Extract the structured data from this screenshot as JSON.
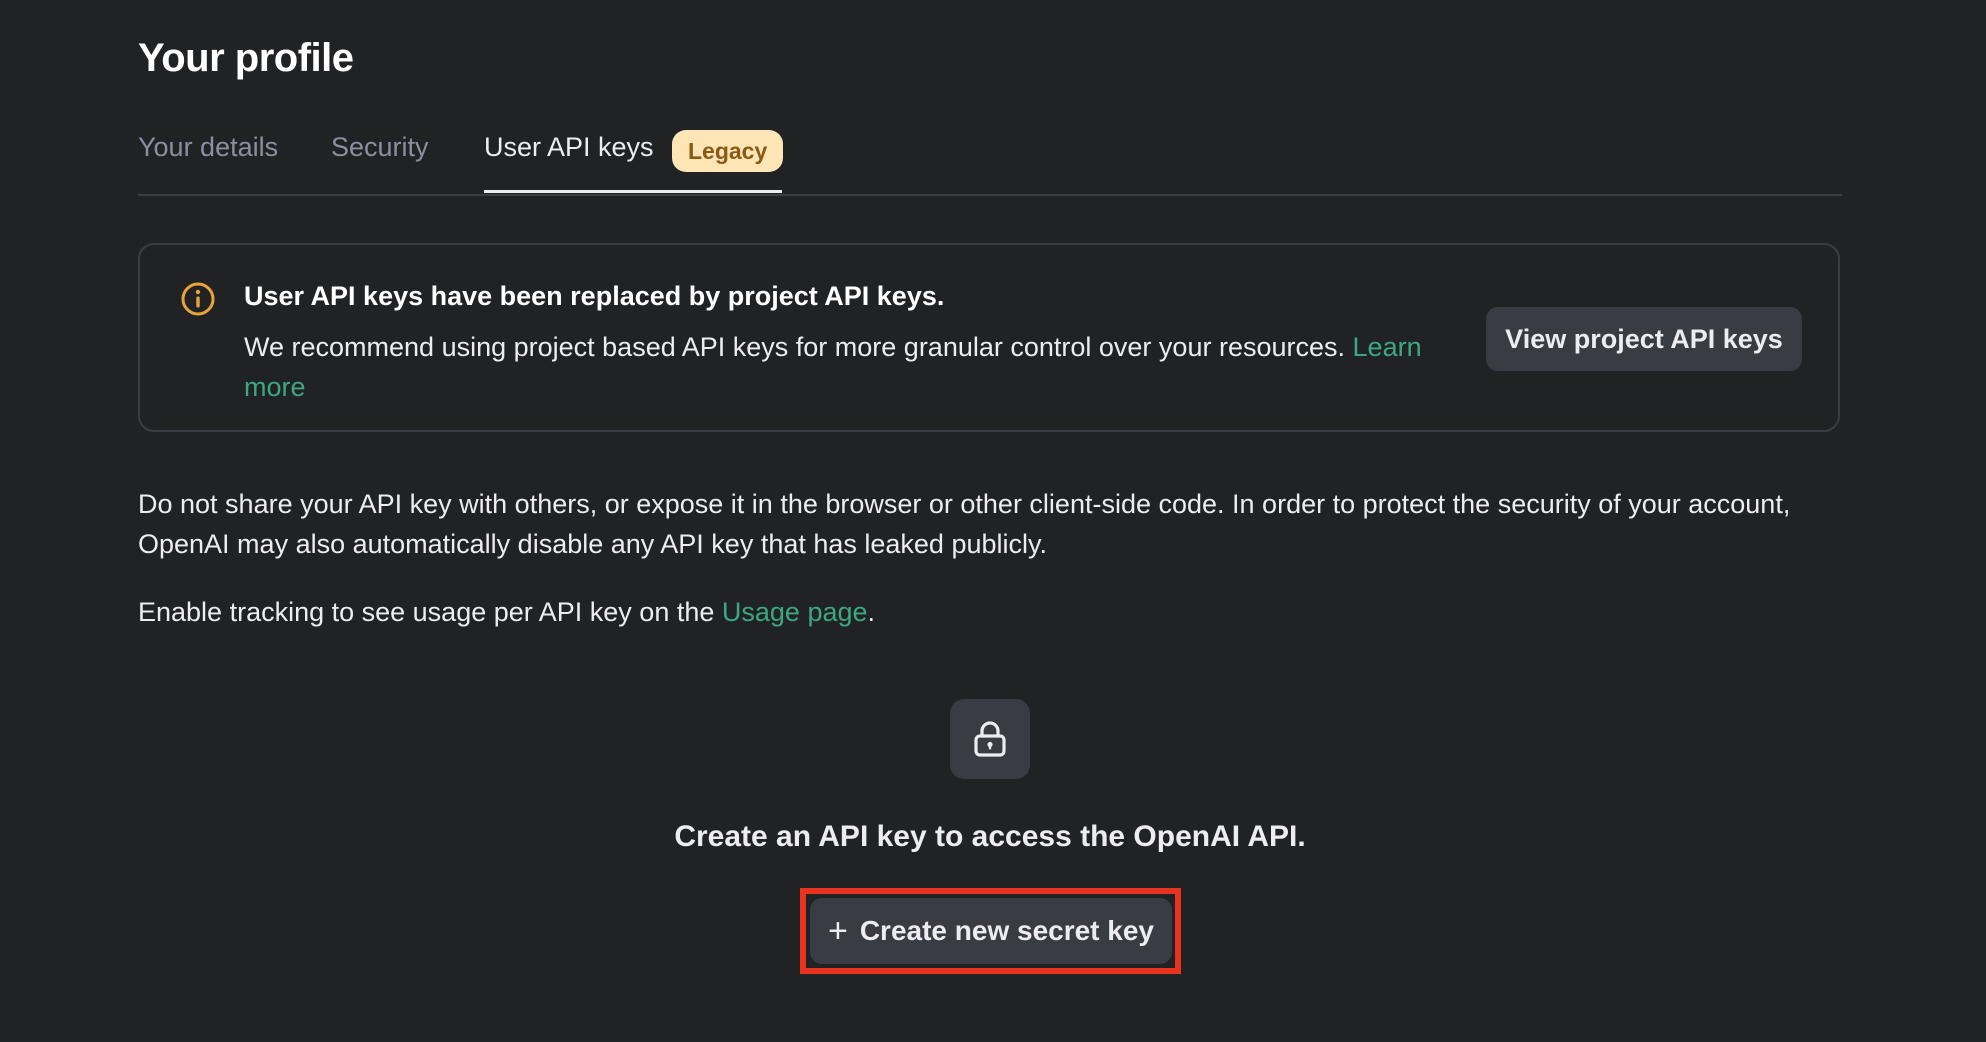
{
  "page": {
    "title": "Your profile"
  },
  "tabs": [
    {
      "label": "Your details"
    },
    {
      "label": "Security"
    },
    {
      "label": "User API keys",
      "badge": "Legacy",
      "active": true
    }
  ],
  "notice": {
    "icon": "info-circle-icon",
    "title": "User API keys have been replaced by project API keys.",
    "body": "We recommend using project based API keys for more granular control over your resources.",
    "link_label": "Learn more",
    "button_label": "View project API keys"
  },
  "warning": {
    "text": "Do not share your API key with others, or expose it in the browser or other client-side code. In order to protect the security of your account, OpenAI may also automatically disable any API key that has leaked publicly."
  },
  "tracking": {
    "text_before": "Enable tracking to see usage per API key on the",
    "link_label": "Usage page",
    "text_after": "."
  },
  "empty_state": {
    "icon": "lock-icon",
    "title": "Create an API key to access the OpenAI API.",
    "button_icon": "plus-icon",
    "button_label": "Create new secret key"
  },
  "colors": {
    "background": "#212224",
    "accent_link": "#3ca882",
    "badge_bg": "#fde5b5",
    "badge_text": "#8a5a14",
    "info_icon": "#e8a33d",
    "highlight_border": "#e8331f"
  }
}
